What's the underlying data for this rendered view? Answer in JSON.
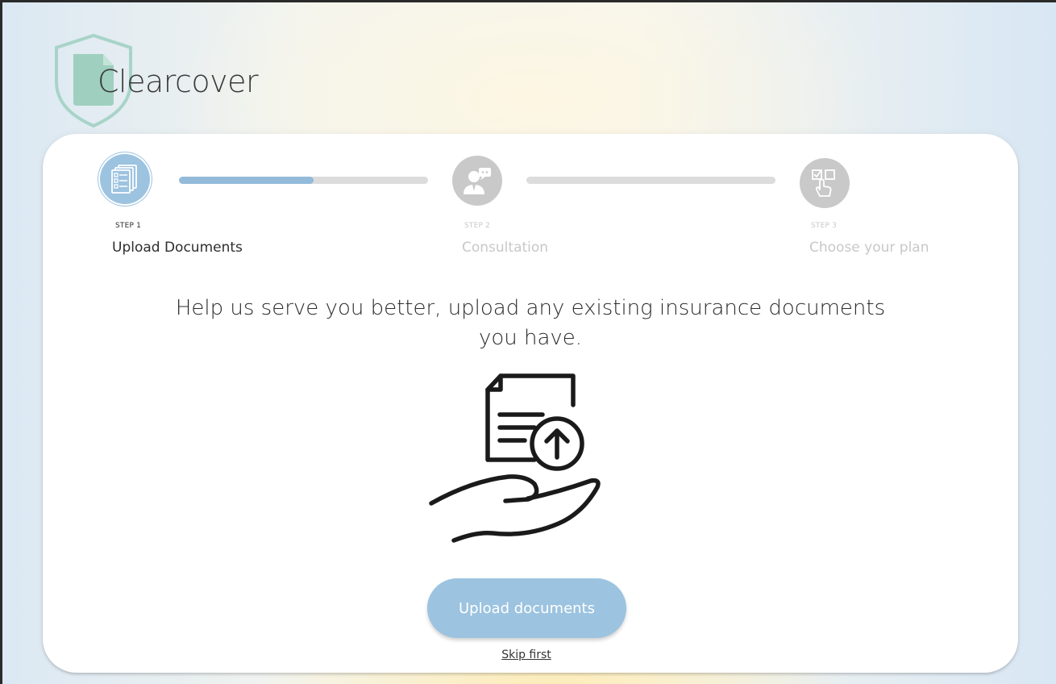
{
  "brand": {
    "name": "Clearcover",
    "shield_color": "#a8d4c8",
    "document_color": "#9fcfbf"
  },
  "stepper": {
    "steps": [
      {
        "number_label": "STEP 1",
        "name": "Upload Documents",
        "icon": "document-checklist-icon",
        "state": "active"
      },
      {
        "number_label": "STEP 2",
        "name": "Consultation",
        "icon": "consultant-icon",
        "state": "inactive"
      },
      {
        "number_label": "STEP 3",
        "name": "Choose your plan",
        "icon": "select-plan-icon",
        "state": "inactive"
      }
    ],
    "progress": [
      0.54,
      0
    ],
    "active_color": "#9cc3e0",
    "inactive_color": "#c9c9c9"
  },
  "main": {
    "headline": "Help us serve you better, upload any existing insurance documents you have.",
    "illustration_icon": "hand-holding-document-upload-icon",
    "upload_button_label": "Upload documents",
    "skip_link_label": "Skip first"
  }
}
